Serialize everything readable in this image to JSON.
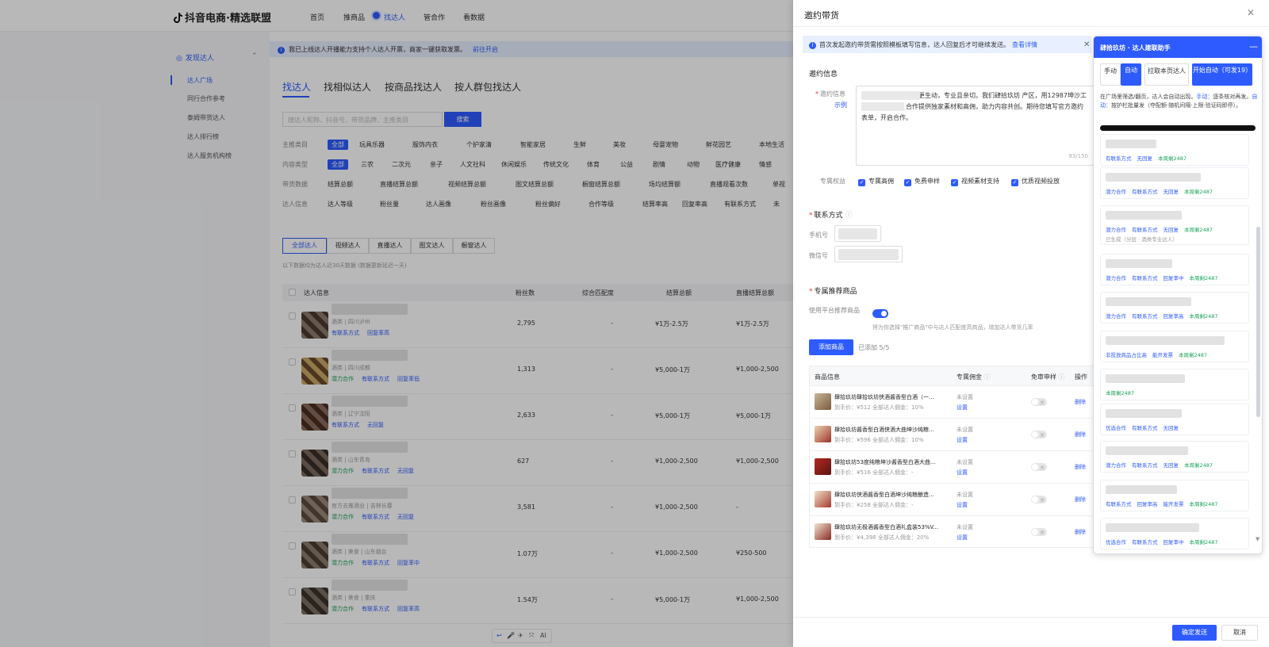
{
  "bg": {
    "logo": "抖音电商·精选联盟",
    "nav": [
      "首页",
      "推商品",
      "找达人",
      "管合作",
      "看数据"
    ],
    "sidebar_section": "发现达人",
    "sidebar_items": [
      "达人广场",
      "同行合作参考",
      "泰姆带货达人",
      "达人排行榜",
      "达人服务机构榜"
    ],
    "notice_text": "我已上线达人开播能力支持个人达人开票，商家一键获取发票。",
    "notice_link": "前往开启",
    "find_tabs": [
      "找达人",
      "找相似达人",
      "按商品找达人",
      "按人群包找达人"
    ],
    "search_placeholder": "搜达人昵称、抖音号、带货品牌、主推类目",
    "search_btn": "搜索",
    "filter_rows": [
      {
        "label": "主推类目",
        "chips": [
          "全部",
          "玩具乐器",
          "服饰内衣",
          "个护家清",
          "智能家居",
          "生鲜",
          "美妆",
          "母婴宠物",
          "鲜花园艺",
          "本地生活"
        ]
      },
      {
        "label": "内容类型",
        "chips": [
          "全部",
          "三农",
          "二次元",
          "亲子",
          "人文社科",
          "休闲娱乐",
          "传统文化",
          "体育",
          "公益",
          "剧情",
          "动物",
          "医疗健康",
          "情感"
        ]
      },
      {
        "label": "带货数据",
        "chips": [
          "结算总额",
          "直播结算总额",
          "视频结算总额",
          "图文结算总额",
          "橱窗结算总额",
          "场均结算额",
          "直播观看次数",
          "单视"
        ]
      },
      {
        "label": "达人信息",
        "chips": [
          "达人等级",
          "粉丝量",
          "达人画像",
          "粉丝画像",
          "粉丝偏好",
          "合作等级",
          "结算率高",
          "回复率高",
          "有联系方式",
          "未"
        ]
      }
    ],
    "seg_tabs": [
      "全部达人",
      "视频达人",
      "直播达人",
      "图文达人",
      "橱窗达人"
    ],
    "sub_note": "以下数据均为达人近30天数据 (数据更新延迟一天)",
    "table_head": [
      "达人信息",
      "粉丝数",
      "综合匹配度",
      "结算总额",
      "直播结算总额"
    ],
    "rows": [
      {
        "loc": "酒类 | 四川泸州",
        "tags": [
          "有联系方式",
          "回复率高"
        ],
        "fans": "2,795",
        "match": "-",
        "gmv": "¥1万-2.5万",
        "live": "¥1万-2.5万"
      },
      {
        "loc": "酒类 | 四川成都",
        "tags": [
          "潜力合作",
          "有联系方式",
          "回复率低"
        ],
        "fans": "1,313",
        "match": "-",
        "gmv": "¥5,000-1万",
        "live": "¥1,000-2,500"
      },
      {
        "loc": "酒类 | 辽宁沈阳",
        "tags": [
          "有联系方式",
          "无回复"
        ],
        "fans": "2,633",
        "match": "-",
        "gmv": "¥5,000-1万",
        "live": "¥5,000-1万"
      },
      {
        "loc": "酒类 | 山东青岛",
        "tags": [
          "潜力合作",
          "有联系方式",
          "无回复"
        ],
        "fans": "627",
        "match": "-",
        "gmv": "¥1,000-2,500",
        "live": "¥1,000-2,500"
      },
      {
        "loc": "官方去推酒业 | 吉林长春",
        "tags": [
          "潜力合作",
          "有联系方式",
          "无回复"
        ],
        "fans": "3,581",
        "match": "-",
        "gmv": "¥1,000-2,500",
        "live": "-"
      },
      {
        "loc": "酒类 | 美食 | 山东烟台",
        "tags": [
          "潜力合作",
          "有联系方式",
          "回复率中"
        ],
        "fans": "1.07万",
        "match": "-",
        "gmv": "¥1,000-2,500",
        "live": "¥250-500"
      },
      {
        "loc": "酒类 | 美食 | 重庆",
        "tags": [
          "潜力合作",
          "有联系方式",
          "回复率高"
        ],
        "fans": "1.54万",
        "match": "-",
        "gmv": "¥5,000-1万",
        "live": "¥1,000-2,500"
      }
    ],
    "mini_toolbar": [
      "↩",
      "🎤",
      "✈",
      "⤧",
      "AI"
    ]
  },
  "drawer": {
    "title": "邀约带货",
    "notice_text": "首次发起邀约带货需按照模板填写信息，达人回复后才可继续发送。",
    "notice_link": "查看详情",
    "sec_invite": "邀约信息",
    "invite_label": "邀约信息",
    "invite_example": "示例",
    "invite_text": "                            您的内容让酱酒文化更生动，专业且亲切。我们肆拾玖坊                        产区，用12987坤沙工艺酿造纯粮酒。合作提供独家素材和高佣，助力内容共创。期待您填写官方邀约表单，开启合作。",
    "invite_count": "93/150",
    "rights_label": "专属权益",
    "rights": [
      "专属高佣",
      "免费申样",
      "视频素材支持",
      "优质视频投放"
    ],
    "sec_contact": "联系方式",
    "phone_label": "手机号",
    "wechat_label": "微信号",
    "sec_goods": "专属推荐商品",
    "use_platform_label": "使用平台推荐商品",
    "use_platform_hint": "将为你选择\"推广商品\"中与达人匹配度高商品，增加达人带货几率",
    "add_btn": "添加商品",
    "added_text": "已添加 5/5",
    "goods_head": [
      "商品信息",
      "专属佣金",
      "免审申样",
      "操作"
    ],
    "goods": [
      {
        "name": "肆拾玖坊肆拾玖坊侠酒酱香型白酒（一...",
        "price": "到手价：¥512   全部达人佣金：10%",
        "commission": "未设置",
        "set": "设置",
        "sw": "关",
        "del": "删除",
        "c1": "#c8b79a",
        "c2": "#7a5b3a"
      },
      {
        "name": "肆拾玖坊酱香型白酒侠酒大曲坤沙纯粮...",
        "price": "到手价：¥596   全部达人佣金：10%",
        "commission": "未设置",
        "set": "设置",
        "sw": "关",
        "del": "删除",
        "c1": "#e8d6b0",
        "c2": "#a0312a"
      },
      {
        "name": "肆拾玖坊53度纯粮坤沙酱香型白酒大曲...",
        "price": "到手价：¥516   全部达人佣金：-",
        "commission": "未设置",
        "set": "设置",
        "sw": "关",
        "del": "删除",
        "c1": "#b32a22",
        "c2": "#5b1410"
      },
      {
        "name": "肆拾玖坊侠酒酱香型白酒坤沙纯粮酿造...",
        "price": "到手价：¥258   全部达人佣金：-",
        "commission": "未设置",
        "set": "设置",
        "sw": "关",
        "del": "删除",
        "c1": "#f1e4cc",
        "c2": "#a6382c"
      },
      {
        "name": "肆拾玖坊无极酒酱香型白酒礼盒装53%V...",
        "price": "到手价：¥4,398   全部达人佣金：20%",
        "commission": "未设置",
        "set": "设置",
        "sw": "关",
        "del": "删除",
        "c1": "#efe4d4",
        "c2": "#8a2a22"
      }
    ],
    "ok_btn": "确定发送",
    "cancel_btn": "取消"
  },
  "assistant": {
    "title": "肆拾玖坊 · 达人建联助手",
    "min": "—",
    "tabs": [
      "手动",
      "自动",
      "拉取本页达人",
      "开始自动（可发19）"
    ],
    "desc_prefix": "在广场里筛选/翻页，达人会自动出现。",
    "desc_manual_k": "手动：",
    "desc_manual": "逐条核对再发。",
    "desc_auto_k": "自动：",
    "desc_auto": "按护栏批量发（夺配额·随机间隔·上限·验证码即停）。",
    "items": [
      {
        "tags": [
          "有联系方式",
          "无回复",
          "本周剩2487"
        ],
        "extra": ""
      },
      {
        "tags": [
          "潜力合作",
          "有联系方式",
          "无回复",
          "本周剩2487"
        ],
        "extra": ""
      },
      {
        "tags": [
          "潜力合作",
          "有联系方式",
          "无回复",
          "本周剩2487"
        ],
        "extra": "已生成（分层 · 酒类专业达人）"
      },
      {
        "tags": [
          "潜力合作",
          "有联系方式",
          "回复率中",
          "本周剩2487"
        ],
        "extra": ""
      },
      {
        "tags": [
          "潜力合作",
          "有联系方式",
          "回复率高",
          "本周剩2487"
        ],
        "extra": ""
      },
      {
        "tags": [
          "非投放商品占比高",
          "能开发票",
          "本周剩2487"
        ],
        "extra": ""
      },
      {
        "tags": [
          "本周剩2487"
        ],
        "extra": ""
      },
      {
        "tags": [
          "优选合作",
          "有联系方式",
          "无回复"
        ],
        "extra": ""
      },
      {
        "tags": [
          "潜力合作",
          "有联系方式",
          "无回复",
          "本周剩2487"
        ],
        "extra": ""
      },
      {
        "tags": [
          "有联系方式",
          "回复率高",
          "能开发票",
          "本周剩2487"
        ],
        "extra": ""
      },
      {
        "tags": [
          "优选合作",
          "有联系方式",
          "回复率中",
          "本周剩2487"
        ],
        "extra": ""
      }
    ]
  }
}
